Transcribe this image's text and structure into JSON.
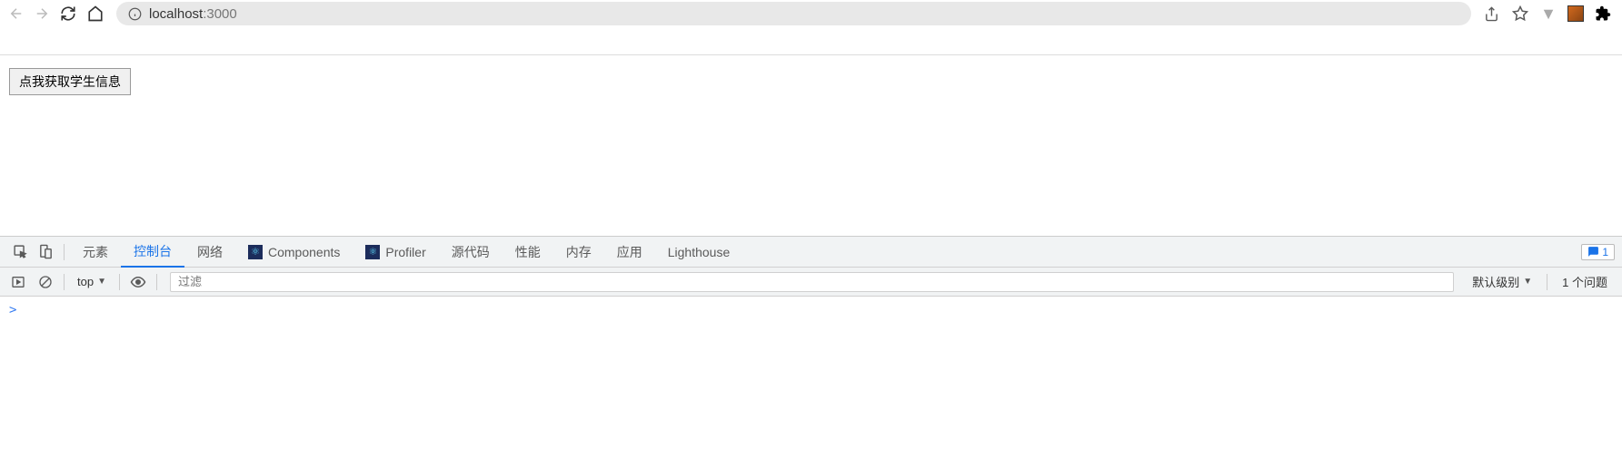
{
  "browser": {
    "url_host": "localhost",
    "url_port": ":3000"
  },
  "page": {
    "button_label": "点我获取学生信息"
  },
  "devtools": {
    "tabs": {
      "elements": "元素",
      "console": "控制台",
      "network": "网络",
      "components": "Components",
      "profiler": "Profiler",
      "sources": "源代码",
      "performance": "性能",
      "memory": "内存",
      "application": "应用",
      "lighthouse": "Lighthouse"
    },
    "msg_count": "1",
    "console_toolbar": {
      "context": "top",
      "filter_placeholder": "过滤",
      "level": "默认级别",
      "problems": "1 个问题"
    },
    "prompt": ">"
  }
}
